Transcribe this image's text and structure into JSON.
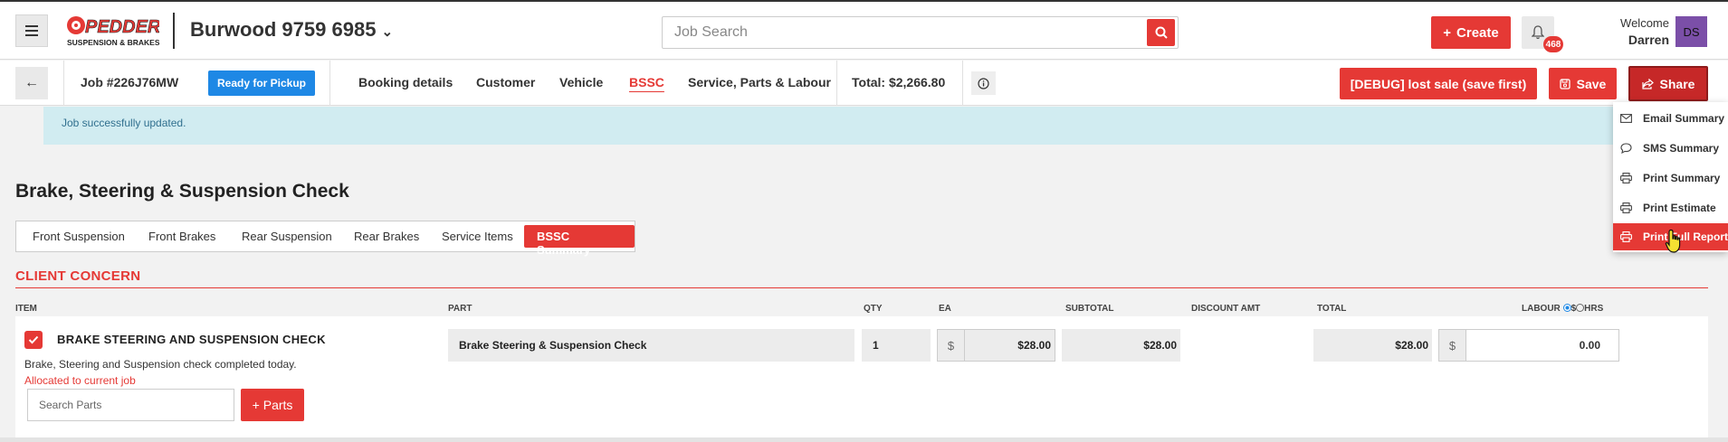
{
  "header": {
    "logo_line1": "PEDDERS",
    "logo_line2": "SUSPENSION & BRAKES",
    "store": "Burwood 9759 6985",
    "search_placeholder": "Job Search",
    "create_label": "Create",
    "notification_count": "468",
    "welcome": "Welcome",
    "user_name": "Darren",
    "avatar_initials": "DS"
  },
  "jobbar": {
    "job_number": "Job #226J76MW",
    "status": "Ready for Pickup",
    "tabs": [
      "Booking details",
      "Customer",
      "Vehicle",
      "BSSC",
      "Service, Parts & Labour"
    ],
    "active_tab": "BSSC",
    "total": "Total: $2,266.80",
    "debug_label": "[DEBUG] lost sale (save first)",
    "save_label": "Save",
    "share_label": "Share"
  },
  "alert": "Job successfully updated.",
  "page_title": "Brake, Steering & Suspension Check",
  "subtabs": [
    "Front Suspension",
    "Front Brakes",
    "Rear Suspension",
    "Rear Brakes",
    "Service Items",
    "BSSC Summary"
  ],
  "section_title": "CLIENT CONCERN",
  "columns": {
    "item": "ITEM",
    "part": "PART",
    "qty": "QTY",
    "ea": "EA",
    "subtotal": "SUBTOTAL",
    "discount": "DISCOUNT AMT",
    "total": "TOTAL",
    "labour": "LABOUR",
    "labour_opt1": "$",
    "labour_opt2": "HRS"
  },
  "row": {
    "name": "BRAKE STEERING AND SUSPENSION CHECK",
    "description": "Brake, Steering and Suspension check completed today.",
    "allocation": "Allocated to current job",
    "search_parts_placeholder": "Search Parts",
    "parts_button": "Parts",
    "part": "Brake Steering & Suspension Check",
    "qty": "1",
    "currency": "$",
    "ea": "$28.00",
    "subtotal": "$28.00",
    "total": "$28.00",
    "labour": "0.00"
  },
  "share_menu": {
    "items": [
      "Email Summary",
      "SMS Summary",
      "Print Summary",
      "Print Estimate",
      "Print Full Report"
    ],
    "hovered": "Print Full Report"
  },
  "colors": {
    "accent_red": "#e53935",
    "status_blue": "#1e88e5",
    "alert_bg": "#d1ecf1"
  }
}
